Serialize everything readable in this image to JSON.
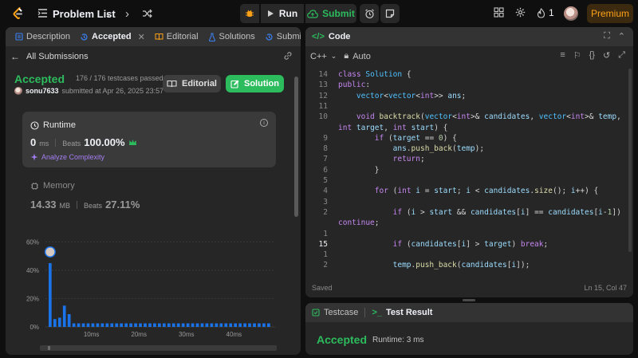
{
  "topbar": {
    "problem_list": "Problem List",
    "run": "Run",
    "submit": "Submit",
    "streak": "1",
    "premium": "Premium"
  },
  "left": {
    "tabs": [
      "Description",
      "Accepted",
      "Editorial",
      "Solutions",
      "Submissions"
    ],
    "all_submissions": "All Submissions",
    "status": "Accepted",
    "passed": "176 / 176 testcases passed",
    "user": "sonu7633",
    "submitted_at": "submitted at Apr 26, 2025 23:57",
    "editorial_btn": "Editorial",
    "solution_btn": "Solution",
    "runtime": {
      "label": "Runtime",
      "value": "0",
      "unit": "ms",
      "beats_label": "Beats",
      "beats": "100.00%",
      "analyze": "Analyze Complexity"
    },
    "memory": {
      "label": "Memory",
      "value": "14.33",
      "unit": "MB",
      "beats_label": "Beats",
      "beats": "27.11%"
    }
  },
  "chart_data": {
    "type": "bar",
    "ylabels": [
      "60%",
      "40%",
      "20%",
      "0%"
    ],
    "ylim": [
      0,
      60
    ],
    "xlabels": [
      "10ms",
      "20ms",
      "30ms",
      "40ms"
    ],
    "values": [
      45,
      5.5,
      6.5,
      15,
      9,
      2.5,
      2.5,
      2.5,
      2.5,
      2.5,
      2.5,
      2.5,
      2.5,
      2.5,
      2.5,
      2.5,
      2.5,
      2.5,
      2.5,
      2.5,
      2.5,
      2.5,
      2.5,
      2.5,
      2.5,
      2.5,
      2.5,
      2.5,
      2.5,
      2.5,
      2.5,
      2.5,
      2.5,
      2.5,
      2.5,
      2.5,
      2.5,
      2.5,
      2.5,
      2.5,
      2.5,
      2.5,
      2.5,
      2.5,
      2.5,
      2.5,
      2.5
    ],
    "highlight_index": 0,
    "bar_color": "#1a73e8"
  },
  "code": {
    "title": "Code",
    "language": "C++",
    "mode": "Auto",
    "saved": "Saved",
    "position": "Ln 15, Col 47",
    "lines": [
      {
        "n": "14",
        "t": "class Solution {"
      },
      {
        "n": "13",
        "t": "public:"
      },
      {
        "n": "12",
        "t": "    vector<vector<int>> ans;"
      },
      {
        "n": "11",
        "t": ""
      },
      {
        "n": "10",
        "t": "    void backtrack(vector<int>& candidates, vector<int>& temp,"
      },
      {
        "n": "",
        "t": "int target, int start) {"
      },
      {
        "n": "9",
        "t": "        if (target == 0) {"
      },
      {
        "n": "8",
        "t": "            ans.push_back(temp);"
      },
      {
        "n": "7",
        "t": "            return;"
      },
      {
        "n": "6",
        "t": "        }"
      },
      {
        "n": "5",
        "t": ""
      },
      {
        "n": "4",
        "t": "        for (int i = start; i < candidates.size(); i++) {"
      },
      {
        "n": "3",
        "t": ""
      },
      {
        "n": "2",
        "t": "            if (i > start && candidates[i] == candidates[i-1])"
      },
      {
        "n": "",
        "t": "continue;"
      },
      {
        "n": "1",
        "t": ""
      },
      {
        "n": "15",
        "t": "            if (candidates[i] > target) break;"
      },
      {
        "n": "1",
        "t": ""
      },
      {
        "n": "2",
        "t": "            temp.push_back(candidates[i]);"
      }
    ]
  },
  "test": {
    "tabs": [
      "Testcase",
      "Test Result"
    ],
    "status": "Accepted",
    "runtime": "Runtime: 3 ms"
  }
}
